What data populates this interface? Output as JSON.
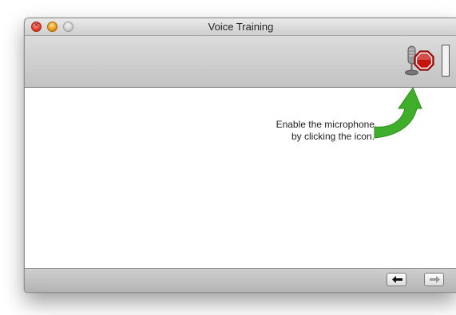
{
  "window": {
    "title": "Voice Training"
  },
  "toolbar": {
    "microphone_button_icon": "microphone-stop-icon",
    "level_meter": 0
  },
  "content": {
    "hint_line1": "Enable the microphone",
    "hint_line2": "by clicking the icon.",
    "arrow_icon": "curved-arrow-icon",
    "arrow_color": "#3fae2a"
  },
  "navigation": {
    "back_icon": "arrow-left-icon",
    "forward_icon": "arrow-right-icon",
    "back_enabled": true,
    "forward_enabled": false
  }
}
